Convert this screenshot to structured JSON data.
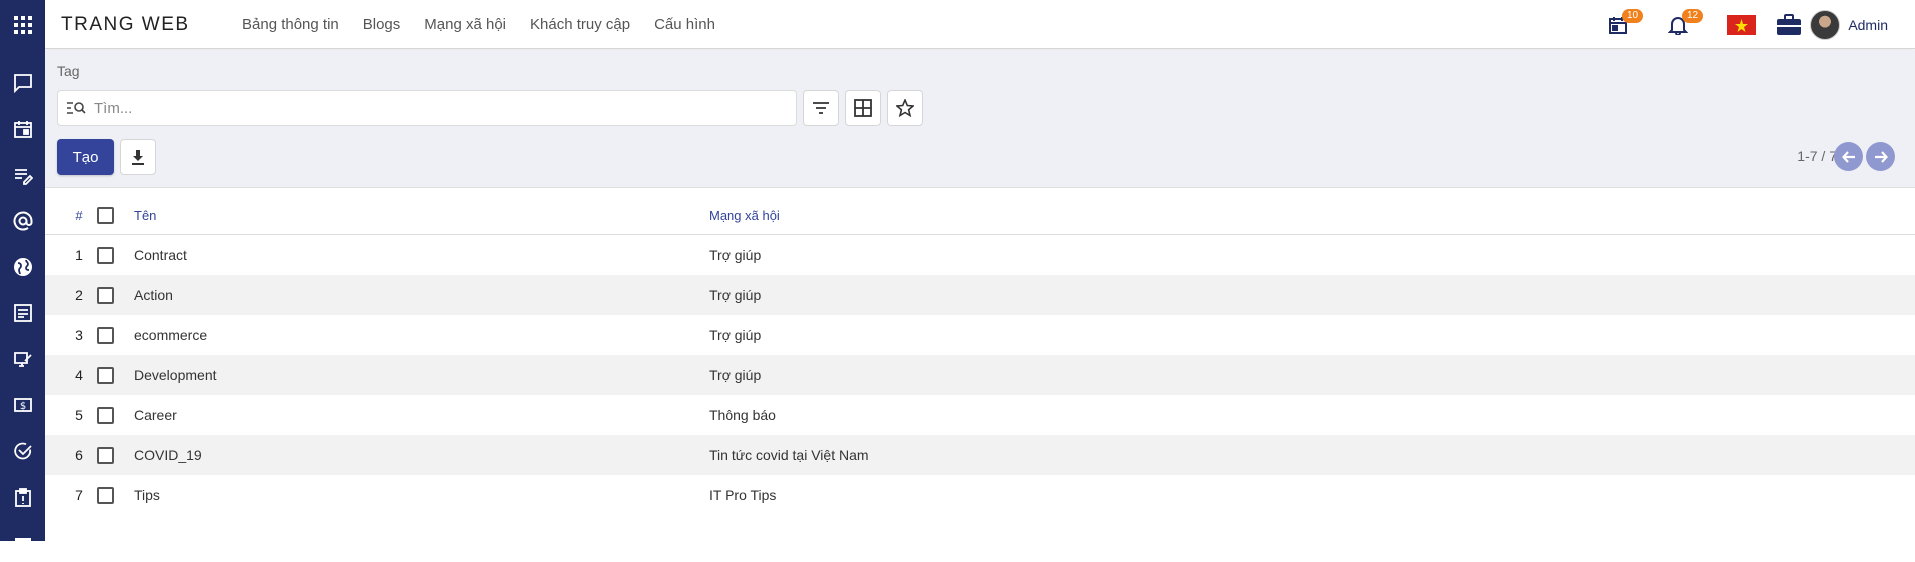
{
  "app": {
    "brand": "TRANG WEB",
    "menu": [
      "Bảng thông tin",
      "Blogs",
      "Mạng xã hội",
      "Khách truy cập",
      "Cấu hình"
    ],
    "calendar_badge": "10",
    "notification_badge": "12",
    "user_name": "Admin",
    "accent_color": "#33449a",
    "sidebar_color": "#1f2b63",
    "badge_color": "#f0811c"
  },
  "sidebar": {
    "icons": [
      "apps-icon",
      "chat-icon",
      "calendar-icon",
      "notes-edit-icon",
      "at-icon",
      "globe-icon",
      "article-icon",
      "website-edit-icon",
      "money-icon",
      "check-circle-icon",
      "clipboard-icon",
      "more-icon"
    ]
  },
  "page": {
    "breadcrumb": "Tag",
    "search_placeholder": "Tìm...",
    "create_label": "Tạo",
    "pager": "1-7 / 7"
  },
  "table": {
    "headers": {
      "num": "#",
      "name": "Tên",
      "network": "Mạng xã hội"
    },
    "rows": [
      {
        "num": "1",
        "name": "Contract",
        "network": "Trợ giúp"
      },
      {
        "num": "2",
        "name": "Action",
        "network": "Trợ giúp"
      },
      {
        "num": "3",
        "name": "ecommerce",
        "network": "Trợ giúp"
      },
      {
        "num": "4",
        "name": "Development",
        "network": "Trợ giúp"
      },
      {
        "num": "5",
        "name": "Career",
        "network": "Thông báo"
      },
      {
        "num": "6",
        "name": "COVID_19",
        "network": "Tin tức covid tại Việt Nam"
      },
      {
        "num": "7",
        "name": "Tips",
        "network": "IT Pro Tips"
      }
    ]
  }
}
